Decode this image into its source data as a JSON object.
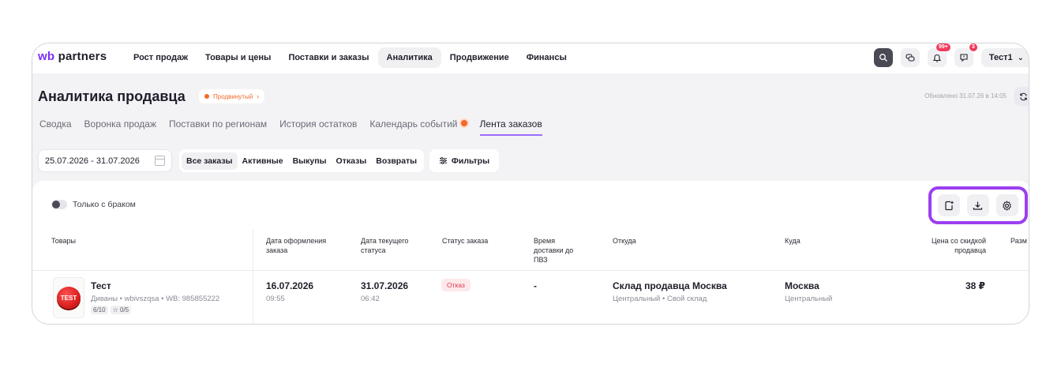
{
  "brand": {
    "wb": "wb",
    "name": "partners"
  },
  "nav": [
    "Рост продаж",
    "Товары и цены",
    "Поставки и заказы",
    "Аналитика",
    "Продвижение",
    "Финансы"
  ],
  "nav_active": "Аналитика",
  "header_right": {
    "notifications_badge": "99+",
    "messages_badge": "3",
    "user": "Тест1"
  },
  "page": {
    "title": "Аналитика продавца",
    "plan": "Продвинутый",
    "updated": "Обновлено 31.07.26 в 14:05"
  },
  "tabs": [
    "Сводка",
    "Воронка продаж",
    "Поставки по регионам",
    "История остатков",
    "Календарь событий",
    "Лента заказов"
  ],
  "tab_active": "Лента заказов",
  "filters": {
    "date_range": "25.07.2026 - 31.07.2026",
    "segments": [
      "Все заказы",
      "Активные",
      "Выкупы",
      "Отказы",
      "Возвраты"
    ],
    "segment_active": "Все заказы",
    "filters_label": "Фильтры",
    "defect_toggle_label": "Только с браком"
  },
  "table": {
    "headers": {
      "goods": "Товары",
      "order_date": "Дата оформления заказа",
      "status_date": "Дата текущего статуса",
      "status": "Статус заказа",
      "delivery_time": "Время доставки до ПВЗ",
      "from": "Откуда",
      "to": "Куда",
      "price": "Цена со скидкой продавца",
      "size": "Разм"
    },
    "row": {
      "thumb_text": "TEST",
      "name": "Тест",
      "meta": "Диваны • wbivszqsa • WB: 985855222",
      "chip_count": "6/10",
      "chip_rating": "☆ 0/5",
      "order_date": "16.07.2026",
      "order_time": "09:55",
      "status_date": "31.07.2026",
      "status_time": "06:42",
      "status": "Отказ",
      "delivery_time": "-",
      "from_main": "Склад продавца Москва",
      "from_sub": "Центральный • Свой склад",
      "to_main": "Москва",
      "to_sub": "Центральный",
      "price": "38 ₽"
    }
  },
  "colors": {
    "accent": "#9b3ff0",
    "brand": "#7b2ff7",
    "status_refuse": "#e0374d",
    "plan": "#f06a2c"
  }
}
